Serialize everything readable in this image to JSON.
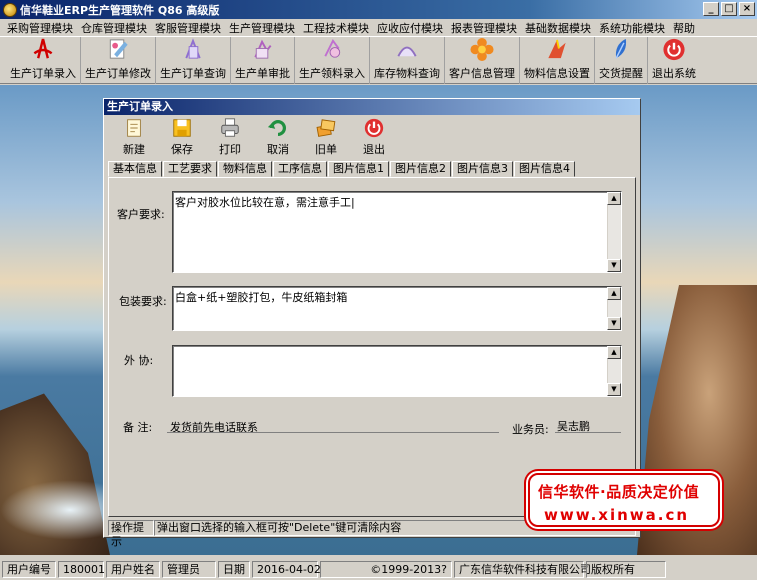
{
  "app": {
    "title": "信华鞋业ERP生产管理软件  Q86 高级版"
  },
  "menu": [
    "采购管理模块",
    "仓库管理模块",
    "客服管理模块",
    "生产管理模块",
    "工程技术模块",
    "应收应付模块",
    "报表管理模块",
    "基础数据模块",
    "系统功能模块",
    "帮助"
  ],
  "toolbar": [
    {
      "label": "生产订单录入",
      "icon": "pdf-doc-icon"
    },
    {
      "label": "生产订单修改",
      "icon": "doc-edit-icon"
    },
    {
      "label": "生产订单查询",
      "icon": "doc-search-icon"
    },
    {
      "label": "生产单审批",
      "icon": "doc-approve-icon"
    },
    {
      "label": "生产领料录入",
      "icon": "material-input-icon"
    },
    {
      "label": "库存物料查询",
      "icon": "stock-search-icon"
    },
    {
      "label": "客户信息管理",
      "icon": "customer-flower-icon"
    },
    {
      "label": "物料信息设置",
      "icon": "material-setting-icon"
    },
    {
      "label": "交货提醒",
      "icon": "feather-pen-icon"
    },
    {
      "label": "退出系统",
      "icon": "power-icon"
    }
  ],
  "child": {
    "title": "生产订单录入",
    "toolbar": [
      {
        "label": "新建",
        "icon": "new-doc-icon"
      },
      {
        "label": "保存",
        "icon": "save-icon"
      },
      {
        "label": "打印",
        "icon": "printer-icon"
      },
      {
        "label": "取消",
        "icon": "undo-icon"
      },
      {
        "label": "旧单",
        "icon": "old-orders-icon"
      },
      {
        "label": "退出",
        "icon": "power-icon"
      }
    ],
    "tabs": [
      "基本信息",
      "工艺要求",
      "物料信息",
      "工序信息",
      "图片信息1",
      "图片信息2",
      "图片信息3",
      "图片信息4"
    ],
    "active_tab": "工艺要求",
    "form": {
      "customer_req_label": "客户要求:",
      "customer_req_value": "客户对胶水位比较在意，需注意手工|",
      "packaging_label": "包装要求:",
      "packaging_value": "白盒+纸+塑胶打包，牛皮纸箱封箱",
      "outsource_label": "外 协:",
      "outsource_value": "",
      "remark_label": "备  注:",
      "remark_value": "发货前先电话联系",
      "salesman_label": "业务员:",
      "salesman_value": "吴志鹏"
    },
    "hint": {
      "label": "操作提示",
      "text": "弹出窗口选择的输入框可按\"Delete\"键可清除内容"
    }
  },
  "watermark": {
    "line1": "信华软件·品质决定价值",
    "line2": "www.xinwa.cn"
  },
  "status": {
    "user_no_label": "用户编号",
    "user_no": "180001",
    "user_name_label": "用户姓名",
    "user_name": "管理员",
    "date_label": "日期",
    "date": "2016-04-02",
    "copyright": "©1999-2013?",
    "company": "广东信华软件科技有限公司",
    "rights": "版权所有"
  }
}
